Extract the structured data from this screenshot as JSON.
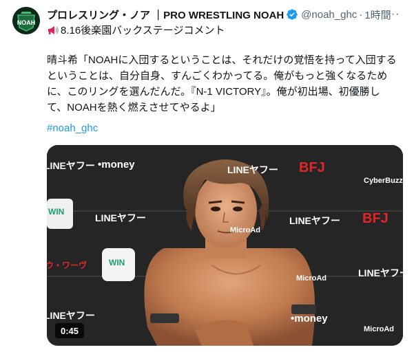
{
  "post": {
    "display_name": "プロレスリング・ノア ｜PRO WRESTLING NOAH",
    "handle": "@noah_ghc",
    "separator": "·",
    "time": "1時間",
    "more_label": "···",
    "intro": "8.16後楽園バックステージコメント",
    "body": "晴斗希「NOAHに入団するということは、それだけの覚悟を持って入団する\nということは、自分自身、すんごくわかってる。俺がもっと強くなるため\nに、このリングを選んだんだ。『N-1 VICTORY』。俺が初出場、初優勝し\nて、NOAHを熱く燃えさせてやるよ」",
    "hashtag": "#noah_ghc"
  },
  "video": {
    "duration": "0:45",
    "sponsors": {
      "lineyahoo": "LINEヤフー",
      "money": "•money",
      "bfj": "BFJ",
      "cyberbuzz": "CyberBuzz",
      "microad": "MicroAd",
      "win": "WIN",
      "ward": "ウ・ワーヴ"
    }
  },
  "colors": {
    "accent": "#1d9bf0",
    "text": "#0f1419",
    "muted": "#536471",
    "brand_green": "#2e8b57"
  },
  "icons": {
    "avatar": "noah-logo",
    "verified": "verified-badge-icon",
    "megaphone": "megaphone-icon",
    "more": "more-icon"
  }
}
